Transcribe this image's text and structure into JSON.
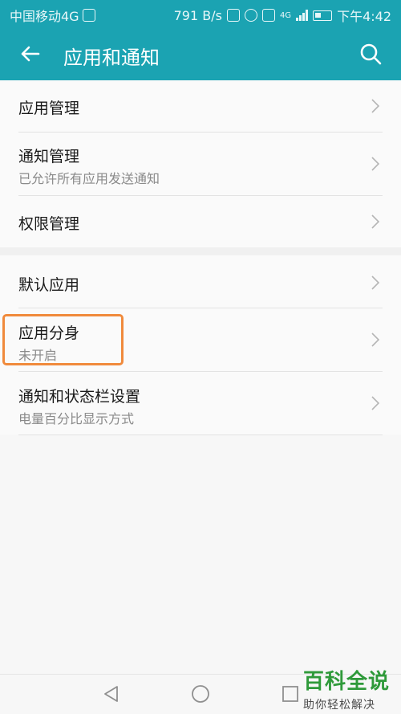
{
  "status_bar": {
    "carrier": "中国移动4G",
    "speed": "791 B/s",
    "network": "4G",
    "time": "下午4:42"
  },
  "app_bar": {
    "title": "应用和通知",
    "back_icon": "back-arrow-icon",
    "search_icon": "search-icon"
  },
  "sections": [
    {
      "items": [
        {
          "label": "应用管理",
          "subtitle": ""
        },
        {
          "label": "通知管理",
          "subtitle": "已允许所有应用发送通知"
        },
        {
          "label": "权限管理",
          "subtitle": ""
        }
      ]
    },
    {
      "items": [
        {
          "label": "默认应用",
          "subtitle": ""
        },
        {
          "label": "应用分身",
          "subtitle": "未开启"
        },
        {
          "label": "通知和状态栏设置",
          "subtitle": "电量百分比显示方式"
        }
      ]
    }
  ],
  "highlight_color": "#f08a3c",
  "accent_color": "#1ba3b2",
  "nav_bar": {
    "icons": [
      "back-triangle-icon",
      "home-circle-icon",
      "recent-square-icon"
    ]
  },
  "watermark": {
    "title": "百科全说",
    "subtitle": "助你轻松解决"
  }
}
